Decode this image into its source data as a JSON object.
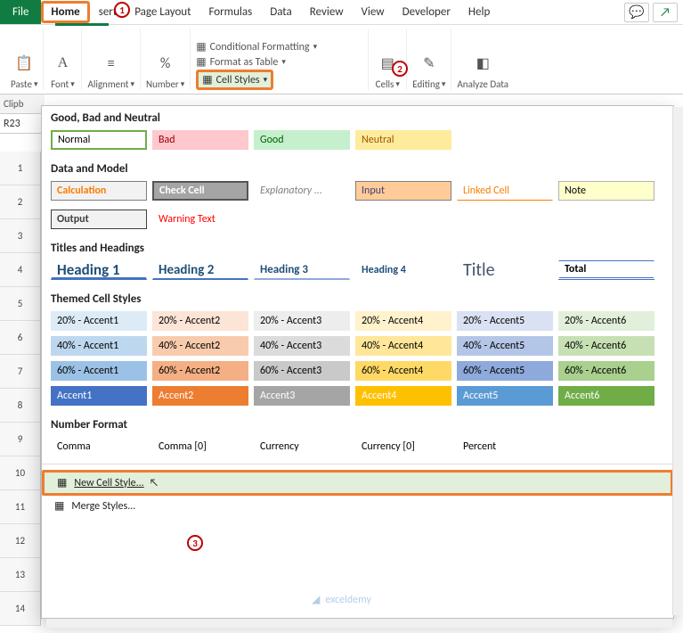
{
  "file_label": "File",
  "tabs": {
    "home": "Home",
    "insert": "sert",
    "pagelayout": "Page Layout",
    "formulas": "Formulas",
    "data": "Data",
    "review": "Review",
    "view": "View",
    "developer": "Developer",
    "help": "Help"
  },
  "ribbon_groups": {
    "paste": "Paste",
    "font": "Font",
    "alignment": "Alignment",
    "number": "Number",
    "cond_format": "Conditional Formatting",
    "format_table": "Format as Table",
    "cell_styles": "Cell Styles",
    "cells": "Cells",
    "editing": "Editing",
    "analyze": "Analyze Data"
  },
  "clipboard_label": "Clipb",
  "namebox": "R23",
  "gallery": {
    "s1": "Good, Bad and Neutral",
    "r1": {
      "normal": "Normal",
      "bad": "Bad",
      "good": "Good",
      "neutral": "Neutral"
    },
    "s2": "Data and Model",
    "r2": {
      "calc": "Calculation",
      "check": "Check Cell",
      "expl": "Explanatory ...",
      "input": "Input",
      "linked": "Linked Cell",
      "note": "Note",
      "output": "Output",
      "warn": "Warning Text"
    },
    "s3": "Titles and Headings",
    "r3": {
      "h1": "Heading 1",
      "h2": "Heading 2",
      "h3": "Heading 3",
      "h4": "Heading 4",
      "title": "Title",
      "total": "Total"
    },
    "s4": "Themed Cell Styles",
    "themed": [
      [
        "20% - Accent1",
        "20% - Accent2",
        "20% - Accent3",
        "20% - Accent4",
        "20% - Accent5",
        "20% - Accent6"
      ],
      [
        "40% - Accent1",
        "40% - Accent2",
        "40% - Accent3",
        "40% - Accent4",
        "40% - Accent5",
        "40% - Accent6"
      ],
      [
        "60% - Accent1",
        "60% - Accent2",
        "60% - Accent3",
        "60% - Accent4",
        "60% - Accent5",
        "60% - Accent6"
      ],
      [
        "Accent1",
        "Accent2",
        "Accent3",
        "Accent4",
        "Accent5",
        "Accent6"
      ]
    ],
    "s5": "Number Format",
    "r5": {
      "comma": "Comma",
      "comma0": "Comma [0]",
      "curr": "Currency",
      "curr0": "Currency [0]",
      "pct": "Percent"
    },
    "new_style": "New Cell Style...",
    "merge": "Merge Styles..."
  },
  "callouts": {
    "one": "1",
    "two": "2",
    "three": "3"
  },
  "theme_colors": {
    "a1": [
      "#DDEBF7",
      "#BDD7EE",
      "#9BC2E6",
      "#4472C4"
    ],
    "a2": [
      "#FCE4D6",
      "#F8CBAD",
      "#F4B084",
      "#ED7D31"
    ],
    "a3": [
      "#EDEDED",
      "#DBDBDB",
      "#C9C9C9",
      "#A5A5A5"
    ],
    "a4": [
      "#FFF2CC",
      "#FFE699",
      "#FFD966",
      "#FFC000"
    ],
    "a5": [
      "#D9E1F2",
      "#B4C6E7",
      "#8EA9DB",
      "#5B9BD5"
    ],
    "a6": [
      "#E2EFDA",
      "#C6E0B4",
      "#A9D08E",
      "#70AD47"
    ]
  },
  "watermark": "exceldemy"
}
